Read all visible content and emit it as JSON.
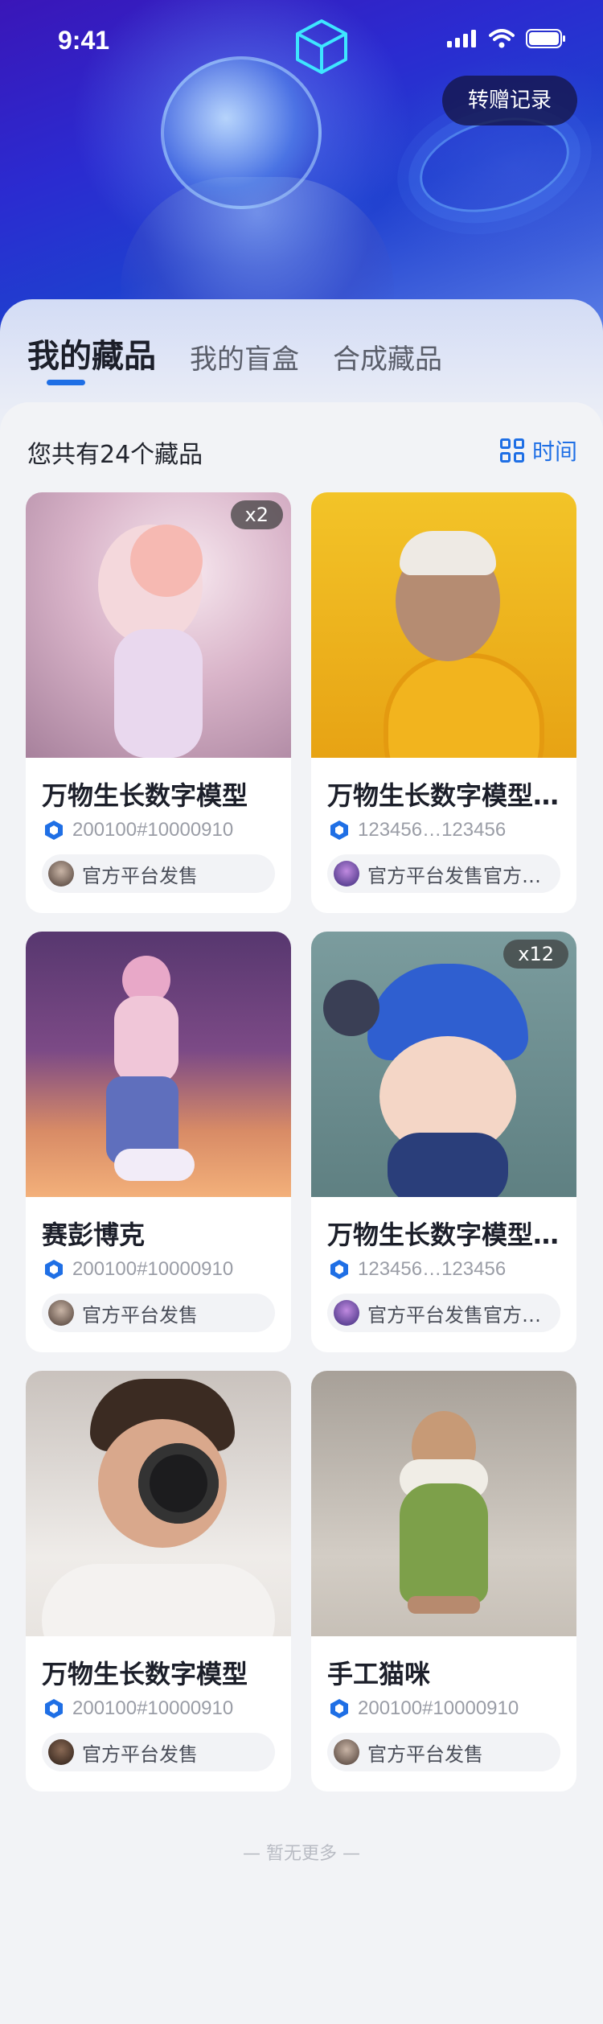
{
  "status": {
    "time": "9:41"
  },
  "header": {
    "transfer_label": "转赠记录"
  },
  "tabs": [
    {
      "label": "我的藏品",
      "active": true
    },
    {
      "label": "我的盲盒",
      "active": false
    },
    {
      "label": "合成藏品",
      "active": false
    }
  ],
  "summary": {
    "count_text": "您共有24个藏品",
    "sort_label": "时间"
  },
  "colors": {
    "accent": "#1f6fe5",
    "background": "#f2f3f6"
  },
  "cards": [
    {
      "title": "万物生长数字模型",
      "id": "200100#10000910",
      "issuer": "官方平台发售",
      "badge": "x2",
      "image": "flower-head-sculpture"
    },
    {
      "title": "万物生长数字模型官方平台发售",
      "id": "123456…123456",
      "issuer": "官方平台发售官方平台发售",
      "badge": "",
      "image": "ape-in-yellow-jacket"
    },
    {
      "title": "赛彭博克",
      "id": "200100#10000910",
      "issuer": "官方平台发售",
      "badge": "",
      "image": "walking-figure-neon"
    },
    {
      "title": "万物生长数字模型官方平台发售",
      "id": "123456…123456",
      "issuer": "官方平台发售官方平台发售",
      "badge": "x12",
      "image": "cyber-girl-toy"
    },
    {
      "title": "万物生长数字模型",
      "id": "200100#10000910",
      "issuer": "官方平台发售",
      "badge": "",
      "image": "photographer"
    },
    {
      "title": "手工猫咪",
      "id": "200100#10000910",
      "issuer": "官方平台发售",
      "badge": "",
      "image": "handmade-cat-figure"
    }
  ],
  "footer": {
    "no_more": "— 暂无更多 —"
  }
}
